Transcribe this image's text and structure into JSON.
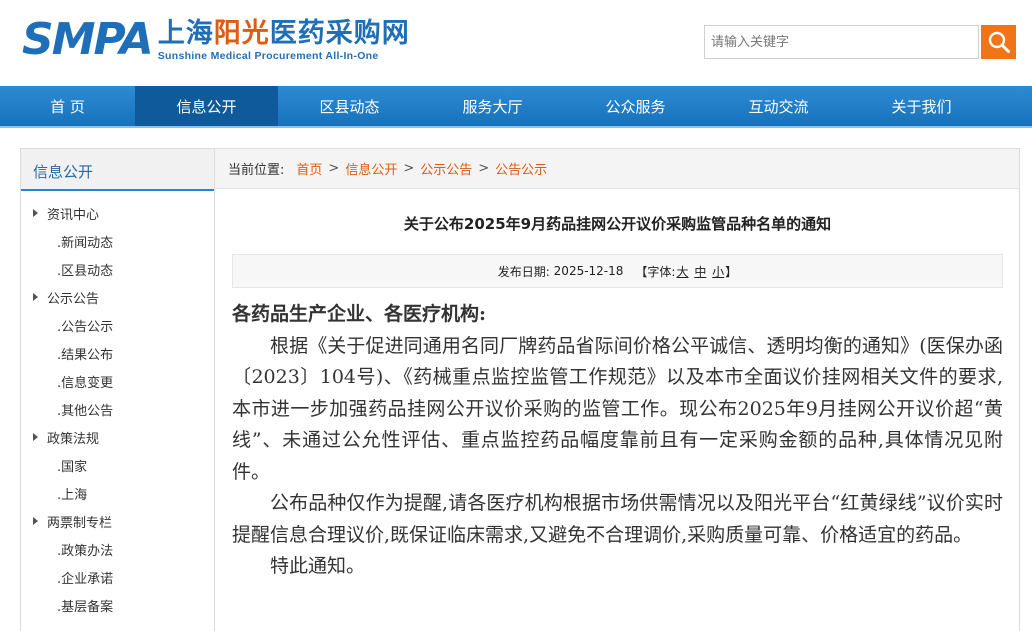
{
  "header": {
    "logo_smpa": "SMPA",
    "logo_cn_part1": "上海",
    "logo_cn_part2": "阳光",
    "logo_cn_part3": "医药",
    "logo_cn_part4": "采购网",
    "logo_en": "Sunshine Medical Procurement All-In-One",
    "search_placeholder": "请输入关键字",
    "search_icon": "search-icon"
  },
  "nav": {
    "items": [
      "首 页",
      "信息公开",
      "区县动态",
      "服务大厅",
      "公众服务",
      "互动交流",
      "关于我们"
    ],
    "active": "信息公开"
  },
  "sidebar": {
    "title": "信息公开",
    "items": [
      {
        "label": "资讯中心",
        "level": 1
      },
      {
        "label": ".新闻动态",
        "level": 2
      },
      {
        "label": ".区县动态",
        "level": 2
      },
      {
        "label": "公示公告",
        "level": 1
      },
      {
        "label": ".公告公示",
        "level": 2
      },
      {
        "label": ".结果公布",
        "level": 2
      },
      {
        "label": ".信息变更",
        "level": 2
      },
      {
        "label": ".其他公告",
        "level": 2
      },
      {
        "label": "政策法规",
        "level": 1
      },
      {
        "label": ".国家",
        "level": 2
      },
      {
        "label": ".上海",
        "level": 2
      },
      {
        "label": "两票制专栏",
        "level": 1
      },
      {
        "label": ".政策办法",
        "level": 2
      },
      {
        "label": ".企业承诺",
        "level": 2
      },
      {
        "label": ".基层备案",
        "level": 2
      }
    ]
  },
  "breadcrumb": {
    "label": "当前位置:",
    "items": [
      "首页",
      "信息公开",
      "公示公告",
      "公告公示"
    ],
    "separator": ">"
  },
  "article": {
    "title": "关于公布2025年9月药品挂网公开议价采购监管品种名单的通知",
    "date_label": "发布日期:",
    "date": "2025-12-18",
    "font_label_open": "【字体:",
    "font_large": "大",
    "font_medium": "中",
    "font_small": "小",
    "font_label_close": "】",
    "salutation": "各药品生产企业、各医疗机构:",
    "paragraphs": [
      "根据《关于促进同通用名同厂牌药品省际间价格公平诚信、透明均衡的通知》(医保办函〔2023〕104号)、《药械重点监控监管工作规范》以及本市全面议价挂网相关文件的要求,本市进一步加强药品挂网公开议价采购的监管工作。现公布2025年9月挂网公开议价超“黄线”、未通过公允性评估、重点监控药品幅度靠前且有一定采购金额的品种,具体情况见附件。",
      "公布品种仅作为提醒,请各医疗机构根据市场供需情况以及阳光平台“红黄绿线”议价实时提醒信息合理议价,既保证临床需求,又避免不合理调价,采购质量可靠、价格适宜的药品。",
      "特此通知。"
    ]
  },
  "colors": {
    "brand_blue": "#1f6fb8",
    "accent_orange": "#e05a10",
    "nav_blue": "#1672bb",
    "nav_active": "#0e5a9a"
  }
}
